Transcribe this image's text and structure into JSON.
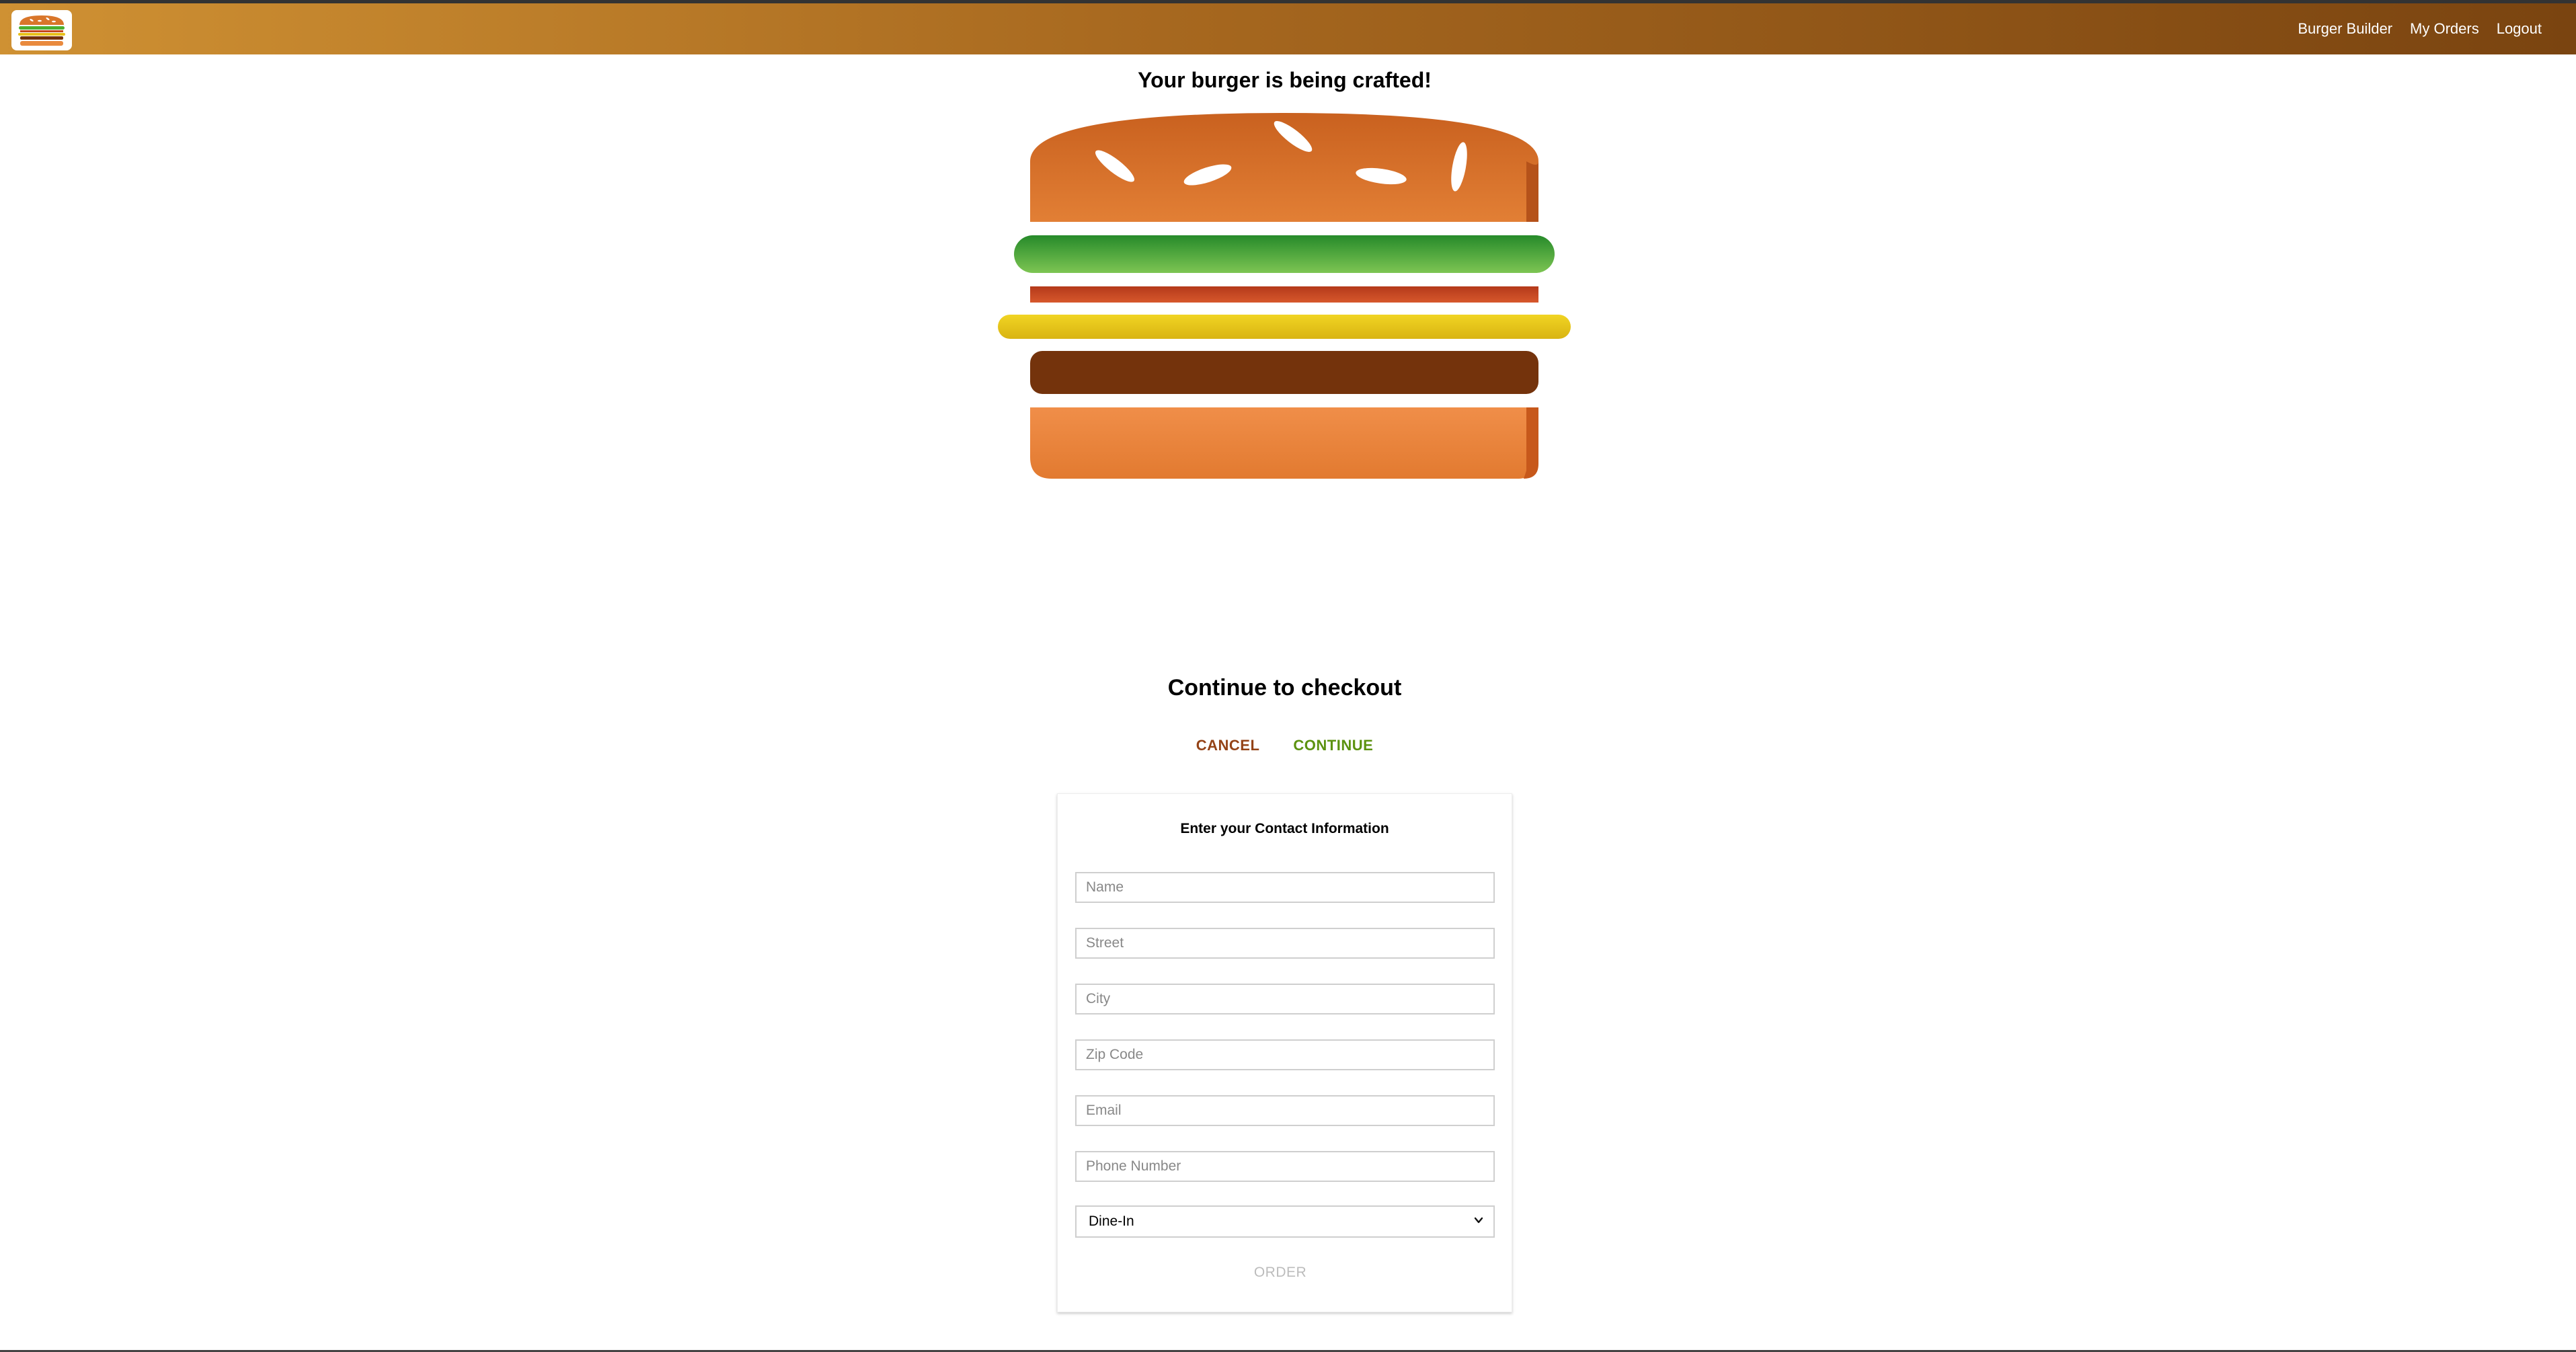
{
  "toolbar": {
    "logo_alt": "burger-logo",
    "nav": [
      {
        "label": "Burger Builder"
      },
      {
        "label": "My Orders"
      },
      {
        "label": "Logout"
      }
    ]
  },
  "burger": {
    "title": "Your burger is being crafted!",
    "ingredients": [
      "bread-top",
      "salad",
      "bacon",
      "cheese",
      "meat",
      "bread-bottom"
    ]
  },
  "checkout": {
    "title": "Continue to checkout",
    "cancel_label": "CANCEL",
    "continue_label": "CONTINUE"
  },
  "contact": {
    "title": "Enter your Contact Information",
    "fields": [
      {
        "placeholder": "Name",
        "value": ""
      },
      {
        "placeholder": "Street",
        "value": ""
      },
      {
        "placeholder": "City",
        "value": ""
      },
      {
        "placeholder": "Zip Code",
        "value": ""
      },
      {
        "placeholder": "Email",
        "value": ""
      },
      {
        "placeholder": "Phone Number",
        "value": ""
      }
    ],
    "delivery_method": "Dine-In",
    "order_label": "ORDER"
  },
  "colors": {
    "toolbar_start": "#cf9133",
    "toolbar_end": "#7a4410",
    "cancel": "#944317",
    "continue": "#5c9210",
    "order_disabled": "#bcbcbc"
  }
}
